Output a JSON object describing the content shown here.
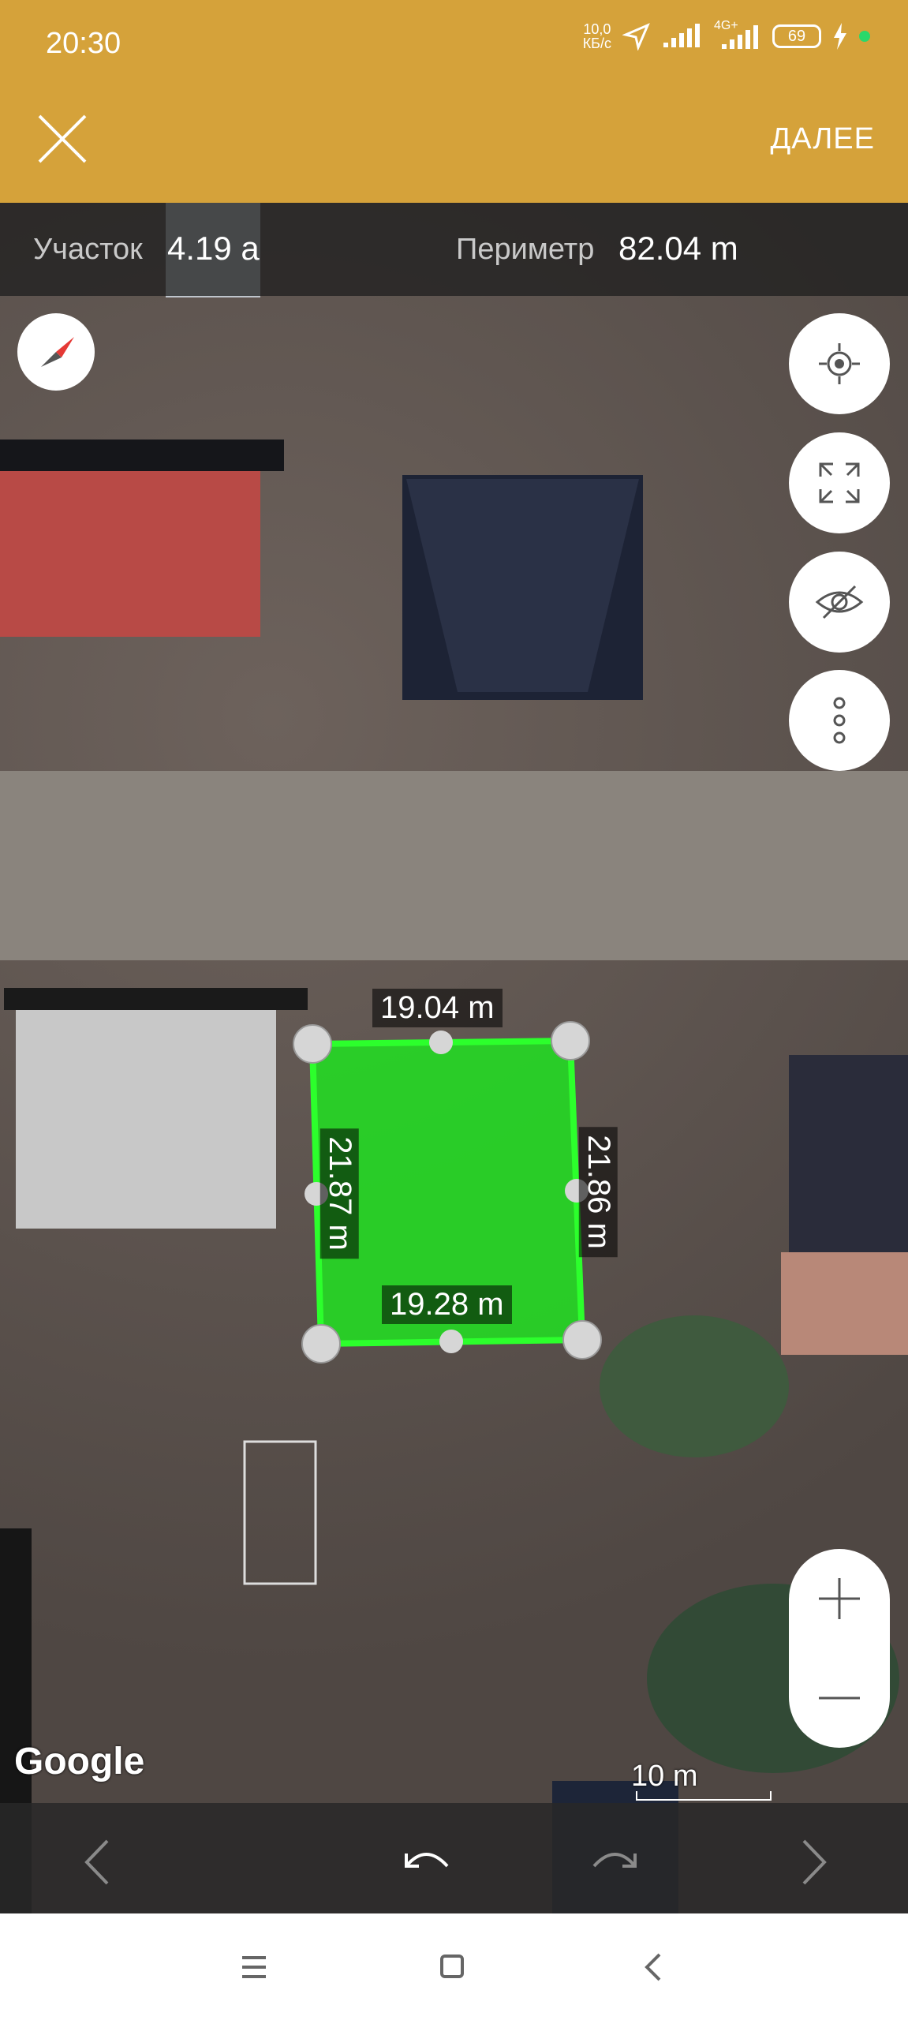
{
  "status_bar": {
    "time": "20:30",
    "speed_value": "10,0",
    "speed_unit": "КБ/с",
    "network": "4G+",
    "battery": "69"
  },
  "toolbar": {
    "close_icon": "close-icon",
    "next_label": "ДАЛЕЕ"
  },
  "info": {
    "area_label": "Участок",
    "area_value": "4.19 a",
    "perimeter_label": "Периметр",
    "perimeter_value": "82.04 m"
  },
  "plot": {
    "top_edge": "19.04 m",
    "bottom_edge": "19.28 m",
    "left_edge": "21.87 m",
    "right_edge": "21.86 m",
    "fill_color": "#22dd22",
    "stroke_color": "#2cff2c"
  },
  "map": {
    "attribution": "Google",
    "scale_label": "10 m"
  },
  "fab_buttons": [
    {
      "name": "my-location-icon"
    },
    {
      "name": "fit-bounds-icon"
    },
    {
      "name": "visibility-off-icon"
    },
    {
      "name": "more-vert-icon"
    }
  ],
  "zoom": {
    "in_icon": "plus-icon",
    "out_icon": "minus-icon"
  },
  "bottom_controls": {
    "prev_icon": "chevron-left-icon",
    "undo_icon": "undo-icon",
    "redo_icon": "redo-icon",
    "next_icon": "chevron-right-icon"
  },
  "system_nav": {
    "menu_icon": "menu-icon",
    "home_icon": "home-square-icon",
    "back_icon": "back-icon"
  }
}
